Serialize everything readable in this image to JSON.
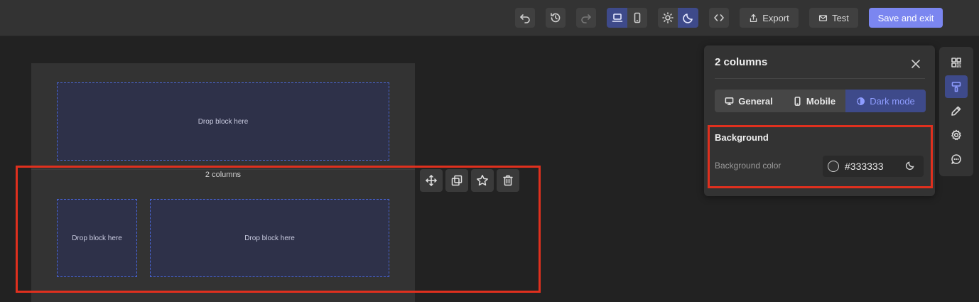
{
  "toolbar": {
    "undo_icon": "undo-icon",
    "history_icon": "history-icon",
    "redo_icon": "redo-icon",
    "desktop_icon": "laptop-icon",
    "mobile_icon": "phone-icon",
    "light_icon": "sun-icon",
    "dark_icon": "moon-icon",
    "code_icon": "code-icon",
    "export_label": "Export",
    "test_label": "Test",
    "save_label": "Save and exit",
    "accent_color": "#7b86f0"
  },
  "canvas": {
    "top_drop_label": "Drop block here",
    "section_label": "2 columns",
    "col1_drop_label": "Drop block here",
    "col2_drop_label": "Drop block here",
    "block_tools": [
      "move-icon",
      "duplicate-icon",
      "star-icon",
      "trash-icon"
    ],
    "highlight_color": "#e0301e"
  },
  "panel": {
    "title": "2 columns",
    "tabs": [
      {
        "label": "General",
        "icon": "monitor-icon"
      },
      {
        "label": "Mobile",
        "icon": "phone-icon"
      },
      {
        "label": "Dark mode",
        "icon": "half-moon-icon"
      }
    ],
    "active_tab": "Dark mode",
    "section_title": "Background",
    "field_label": "Background color",
    "color_value": "#333333"
  },
  "iconbar": {
    "items": [
      "blocks-icon",
      "paint-roller-icon",
      "pencil-icon",
      "gear-icon",
      "chat-icon"
    ],
    "active": "paint-roller-icon"
  }
}
